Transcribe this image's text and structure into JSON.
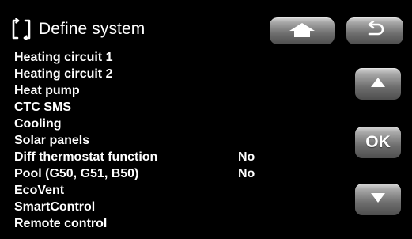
{
  "header": {
    "title": "Define system",
    "icon": "define-system-icon"
  },
  "menu": {
    "items": [
      {
        "label": "Heating circuit 1",
        "value": ""
      },
      {
        "label": "Heating circuit 2",
        "value": ""
      },
      {
        "label": "Heat pump",
        "value": ""
      },
      {
        "label": "CTC SMS",
        "value": ""
      },
      {
        "label": "Cooling",
        "value": ""
      },
      {
        "label": "Solar panels",
        "value": ""
      },
      {
        "label": "Diff thermostat function",
        "value": "No"
      },
      {
        "label": "Pool (G50, G51, B50)",
        "value": "No"
      },
      {
        "label": "EcoVent",
        "value": ""
      },
      {
        "label": "SmartControl",
        "value": ""
      },
      {
        "label": "Remote control",
        "value": ""
      }
    ]
  },
  "buttons": {
    "home_icon": "home-icon",
    "back_icon": "back-arrow-icon",
    "up_icon": "up-arrow-icon",
    "ok_label": "OK",
    "down_icon": "down-arrow-icon"
  },
  "colors": {
    "background": "#000000",
    "text": "#ffffff",
    "button_top": "#d8d8d8",
    "button_bottom": "#4e4e4e"
  }
}
